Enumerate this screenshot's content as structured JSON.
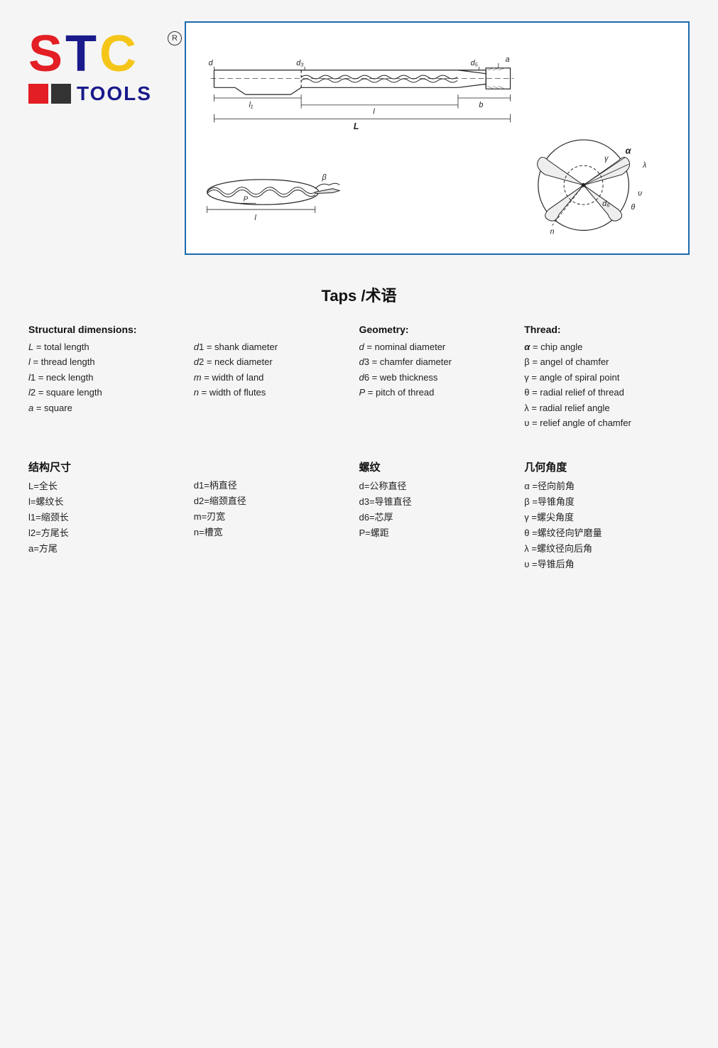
{
  "page": {
    "title": "Taps /术语"
  },
  "logo": {
    "s": "S",
    "t": "T",
    "c": "C",
    "tools": "TOOLS",
    "registered": "®"
  },
  "structural_dimensions": {
    "header": "Structural dimensions:",
    "left_items": [
      "L = total length",
      "l = thread length",
      "l1 = neck length",
      "l2 = square length",
      "a = square"
    ],
    "right_items": [
      "d1 = shank diameter",
      "d2 = neck diameter",
      "m = width of land",
      "n = width of flutes"
    ]
  },
  "geometry": {
    "header": "Geometry:",
    "items": [
      "d = nominal diameter",
      "d3 = chamfer diameter",
      "d6 = web thickness",
      "P = pitch of thread"
    ]
  },
  "thread": {
    "header": "Thread:",
    "items": [
      "α  = chip angle",
      "β = angel of chamfer",
      "γ = angle of spiral point",
      "θ = radial relief of thread",
      "λ = radial relief angle",
      "υ = relief angle of chamfer"
    ]
  },
  "cn_structural": {
    "header": "结构尺寸",
    "left_items": [
      "L=全长",
      "l=螺纹长",
      "l1=缩颈长",
      "l2=方尾长",
      "a=方尾"
    ],
    "right_items": [
      "d1=柄直径",
      "d2=缩颈直径",
      "m=刃宽",
      "n=槽宽"
    ]
  },
  "cn_thread": {
    "header": "螺纹",
    "items": [
      "d=公称直径",
      "d3=导锥直径",
      "d6=芯厚",
      "P=螺距"
    ]
  },
  "cn_geometry": {
    "header": "几何角度",
    "items": [
      "α =径向前角",
      "β =导锥角度",
      "γ =螺尖角度",
      "θ =螺纹径向铲磨量",
      "λ =螺纹径向后角",
      "υ =导锥后角"
    ]
  }
}
